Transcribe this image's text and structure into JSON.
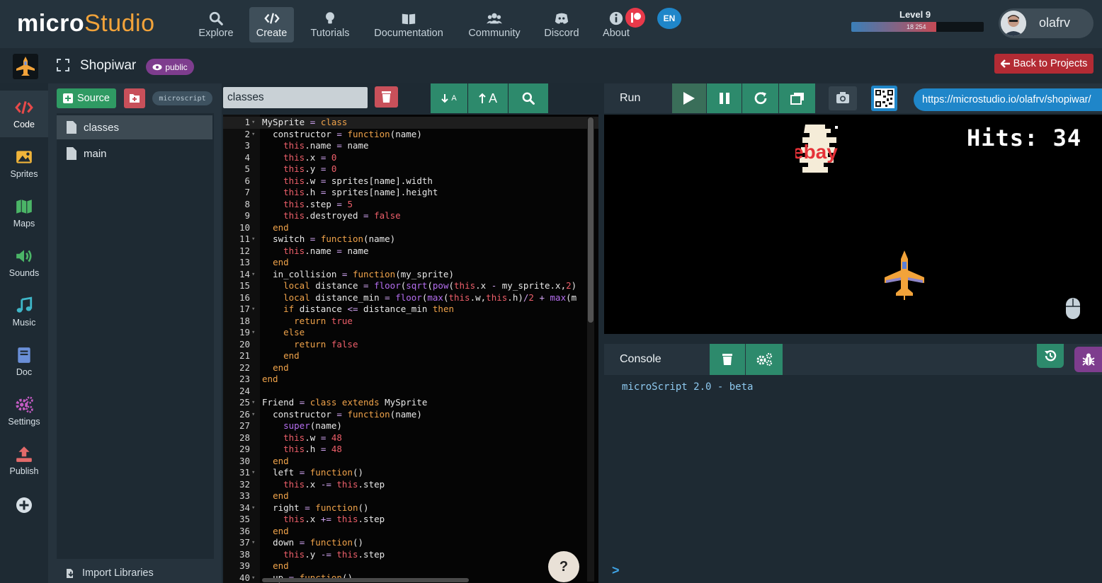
{
  "app": {
    "logo_main": "micro",
    "logo_sub": "Studio",
    "nav": [
      {
        "label": "Explore",
        "icon": "search-icon"
      },
      {
        "label": "Create",
        "icon": "code-icon"
      },
      {
        "label": "Tutorials",
        "icon": "lightbulb-icon"
      },
      {
        "label": "Documentation",
        "icon": "book-icon"
      },
      {
        "label": "Community",
        "icon": "users-icon"
      },
      {
        "label": "Discord",
        "icon": "discord-icon"
      },
      {
        "label": "About",
        "icon": "info-icon"
      }
    ],
    "active_nav": "Create",
    "language": "EN",
    "level_label": "Level 9",
    "xp_text": "18 254",
    "xp_progress": 0.64,
    "username": "olafrv"
  },
  "project": {
    "name": "Shopiwar",
    "visibility": "public",
    "back_label": "Back to Projects"
  },
  "sidebar": [
    {
      "label": "Code",
      "icon": "code-icon",
      "color": "#e84a4a"
    },
    {
      "label": "Sprites",
      "icon": "image-icon",
      "color": "#f0b43a"
    },
    {
      "label": "Maps",
      "icon": "map-icon",
      "color": "#4bb567"
    },
    {
      "label": "Sounds",
      "icon": "volume-icon",
      "color": "#4bb567"
    },
    {
      "label": "Music",
      "icon": "music-icon",
      "color": "#3fb6c8"
    },
    {
      "label": "Doc",
      "icon": "document-icon",
      "color": "#6a8fd8"
    },
    {
      "label": "Settings",
      "icon": "cogs-icon",
      "color": "#c45bc4"
    },
    {
      "label": "Publish",
      "icon": "upload-icon",
      "color": "#e36a6a"
    }
  ],
  "files": {
    "source_label": "Source",
    "language_tag": "microscript",
    "items": [
      "classes",
      "main"
    ],
    "active": "classes",
    "import_label": "Import Libraries"
  },
  "editor": {
    "filename": "classes",
    "lines": [
      "MySprite = class",
      "  constructor = function(name)",
      "    this.name = name",
      "    this.x = 0",
      "    this.y = 0",
      "    this.w = sprites[name].width",
      "    this.h = sprites[name].height",
      "    this.step = 5",
      "    this.destroyed = false",
      "  end",
      "  switch = function(name)",
      "    this.name = name",
      "  end",
      "  in_collision = function(my_sprite)",
      "    local distance = floor(sqrt(pow(this.x - my_sprite.x,2)",
      "    local distance_min = floor(max(this.w,this.h)/2 + max(m",
      "    if distance <= distance_min then",
      "      return true",
      "    else",
      "      return false",
      "    end",
      "  end",
      "end",
      "",
      "Friend = class extends MySprite",
      "  constructor = function(name)",
      "    super(name)",
      "    this.w = 48",
      "    this.h = 48",
      "  end",
      "  left = function()",
      "    this.x -= this.step",
      "  end",
      "  right = function()",
      "    this.x += this.step",
      "  end",
      "  down = function()",
      "    this.y -= this.step",
      "  end",
      "  up = function()"
    ],
    "fold_lines": [
      1,
      2,
      11,
      14,
      17,
      19,
      25,
      26,
      31,
      34,
      37,
      40
    ]
  },
  "run": {
    "label": "Run",
    "url": "https://microstudio.io/olafrv/shopiwar/",
    "hits_text": "Hits: 34",
    "enemy_logo": "ebay"
  },
  "console": {
    "label": "Console",
    "output": "microScript 2.0 - beta",
    "prompt": ">"
  },
  "colors": {
    "accent_green": "#2d8a6c",
    "danger_red": "#c8505a",
    "brand_orange": "#f2a33a",
    "url_blue": "#1f86c9",
    "public_purple": "#7e3d8e"
  }
}
